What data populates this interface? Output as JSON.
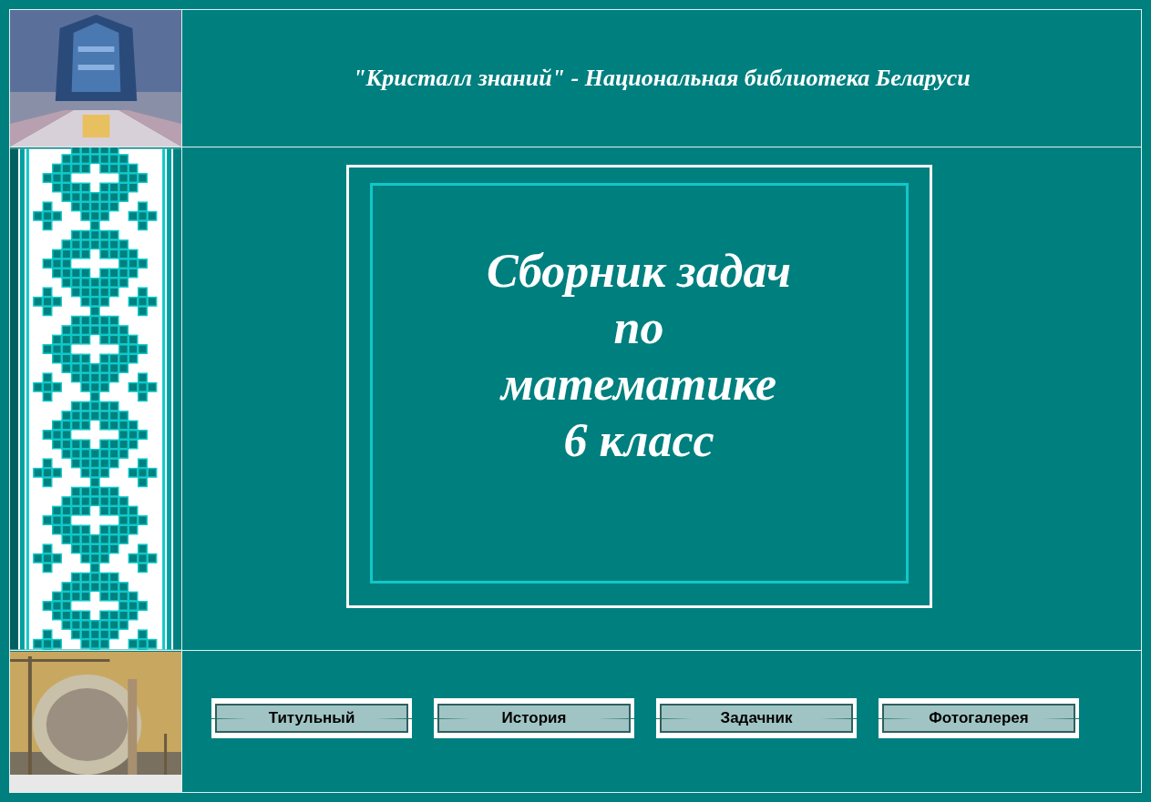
{
  "header": {
    "title": "\"Кристалл знаний\" - Национальная библиотека Беларуси"
  },
  "cover": {
    "title_lines": [
      "Сборник задач",
      "по",
      "математике",
      "6 класс"
    ]
  },
  "nav": {
    "buttons": [
      "Титульный",
      "История",
      "Задачник",
      "Фотогалерея"
    ]
  }
}
